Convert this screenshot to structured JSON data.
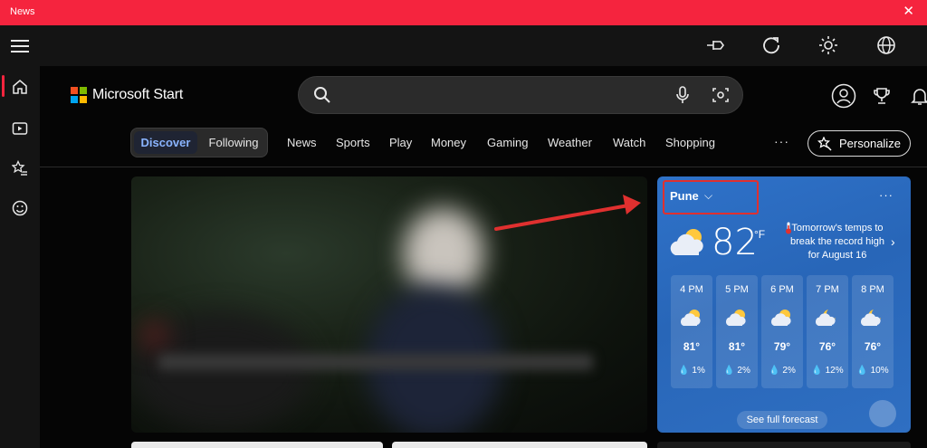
{
  "window": {
    "title": "News",
    "close_glyph": "✕"
  },
  "toolbar": {
    "menu_icon": "hamburger-icon",
    "icons": [
      "pin-icon",
      "refresh-icon",
      "brightness-icon",
      "globe-icon"
    ]
  },
  "rail": {
    "items": [
      "home-icon",
      "video-icon",
      "favorites-icon",
      "feedback-smiley-icon"
    ]
  },
  "brand": {
    "name": "Microsoft Start",
    "logo_colors": [
      "#f25022",
      "#7fba00",
      "#00a4ef",
      "#ffb900"
    ]
  },
  "search": {
    "placeholder": "",
    "icons": [
      "search-icon",
      "microphone-icon",
      "visual-search-icon"
    ]
  },
  "header_icons": [
    "account-icon",
    "rewards-trophy-icon",
    "notification-bell-icon"
  ],
  "tabs": {
    "discover": "Discover",
    "following": "Following",
    "links": [
      "News",
      "Sports",
      "Play",
      "Money",
      "Gaming",
      "Weather",
      "Watch",
      "Shopping"
    ],
    "more": "···",
    "personalize": "Personalize"
  },
  "weather": {
    "location": "Pune",
    "location_chevron": "⌵",
    "menu": "···",
    "temperature": "82",
    "unit": "°F",
    "alert": "Tomorrow's temps to break the record high for August 16",
    "alert_chevron": "›",
    "hourly": [
      {
        "time": "4 PM",
        "temp": "81°",
        "precip": "💧 1%",
        "icon": "partly-sunny-icon"
      },
      {
        "time": "5 PM",
        "temp": "81°",
        "precip": "💧 2%",
        "icon": "partly-sunny-icon"
      },
      {
        "time": "6 PM",
        "temp": "79°",
        "precip": "💧 2%",
        "icon": "partly-sunny-icon"
      },
      {
        "time": "7 PM",
        "temp": "76°",
        "precip": "💧 12%",
        "icon": "partly-cloudy-night-icon"
      },
      {
        "time": "8 PM",
        "temp": "76°",
        "precip": "💧 10%",
        "icon": "partly-cloudy-night-icon"
      }
    ],
    "full_forecast": "See full forecast"
  },
  "colors": {
    "title_bar": "#f5243e",
    "accent": "#8ab4ff",
    "annotation": "#e0302f",
    "weather_bg": "#2b6bbf"
  }
}
